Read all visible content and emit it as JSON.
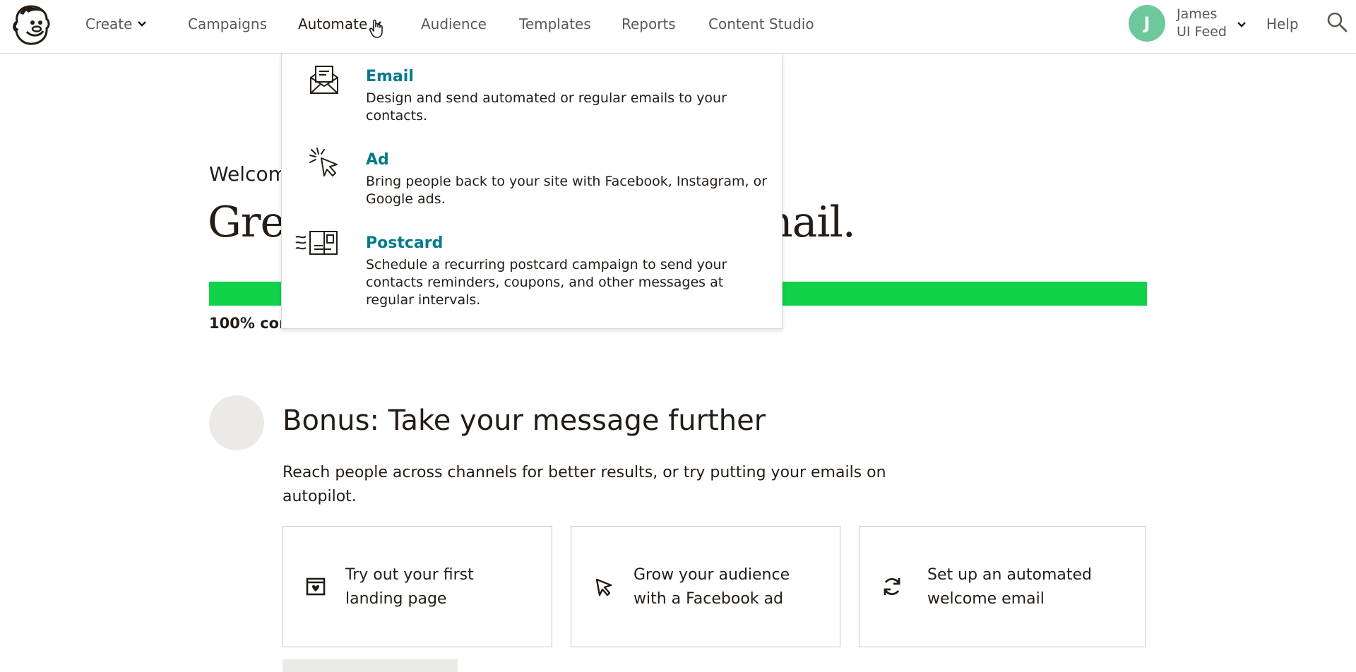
{
  "nav": {
    "logo_icon": "mailchimp-freddie-logo",
    "items": [
      {
        "label": "Create",
        "has_chevron": true
      },
      {
        "label": "Campaigns"
      },
      {
        "label": "Automate",
        "has_chevron": true,
        "active": true
      },
      {
        "label": "Audience"
      },
      {
        "label": "Templates"
      },
      {
        "label": "Reports"
      },
      {
        "label": "Content Studio"
      }
    ],
    "user": {
      "initial": "J",
      "name_line1": "James",
      "name_line2": "UI Feed",
      "avatar_color": "#6dc99c"
    },
    "help_label": "Help",
    "search_icon": "search-icon"
  },
  "dropdown": {
    "items": [
      {
        "title": "Email",
        "description": "Design and send automated or regular emails to your contacts.",
        "icon": "envelope-icon"
      },
      {
        "title": "Ad",
        "description": "Bring people back to your site with Facebook, Instagram, or Google ads.",
        "icon": "cursor-click-icon"
      },
      {
        "title": "Postcard",
        "description": "Schedule a recurring postcard campaign to send your contacts reminders, coupons, and other messages at regular intervals.",
        "icon": "postcard-icon"
      }
    ],
    "title_color": "#007c89"
  },
  "main": {
    "welcome_visible": "Welcom",
    "headline_start": "Gre",
    "headline_end": "nail.",
    "progress": {
      "percent": 100,
      "label_visible": "100% cor",
      "fill_color": "#0fd249"
    },
    "bonus": {
      "title": "Bonus: Take your message further",
      "description": "Reach people across channels for better results, or try putting your emails on autopilot."
    },
    "cards": [
      {
        "text": "Try out your first landing page",
        "icon": "landing-page-icon"
      },
      {
        "text": "Grow your audience with a Facebook ad",
        "icon": "cursor-icon"
      },
      {
        "text": "Set up an automated welcome email",
        "icon": "refresh-icon"
      }
    ]
  }
}
